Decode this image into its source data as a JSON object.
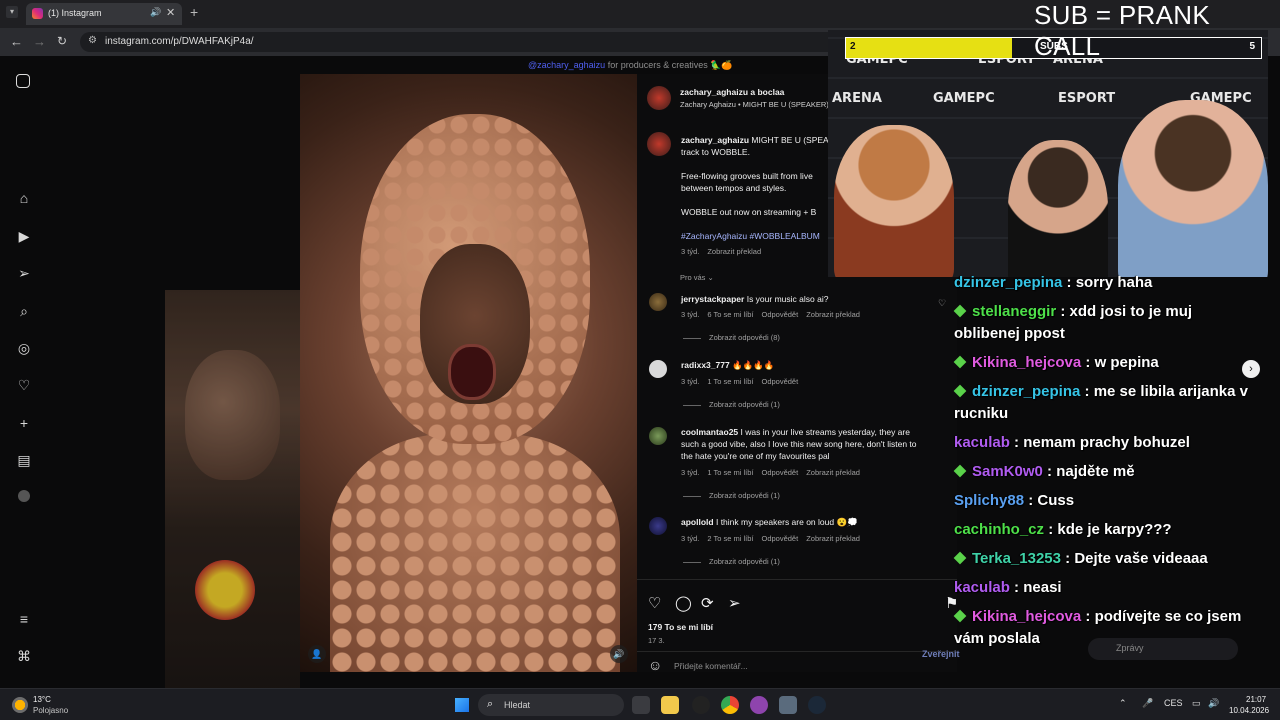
{
  "browser": {
    "tab_title": "(1) Instagram",
    "url": "instagram.com/p/DWAHFAKjP4a/"
  },
  "overlay": {
    "title": "SUB = PRANK CALL",
    "sub_goal": {
      "current": "2",
      "label": "SUBS",
      "target": "5",
      "progress": 0.4
    },
    "cam_brands": [
      "GAMEPC",
      "ESPORT",
      "ARENA"
    ]
  },
  "instagram": {
    "top_caption": {
      "handle": "@zachary_aghaizu",
      "text": " for producers & creatives 🦜🍊"
    },
    "header": {
      "user": "zachary_aghaizu a boclaa",
      "subtitle": "Zachary Aghaizu • MIGHT BE U (SPEAKER)"
    },
    "caption": {
      "user": "zachary_aghaizu",
      "line1": "MIGHT BE U (SPEA",
      "line2": "track to WOBBLE.",
      "para2_line1": "Free-flowing grooves built from live",
      "para2_line2": "between tempos and styles.",
      "para3": "WOBBLE out now on streaming + B",
      "hashtags": "#ZacharyAghaizu #WOBBLEALBUM",
      "time": "3 týd.",
      "translate": "Zobrazit překlad"
    },
    "for_you": "Pro vás ⌄",
    "comments": [
      {
        "user": "jerrystackpaper",
        "text": "Is your music also ai?",
        "time": "3 týd.",
        "likes": "6 To se mi líbí",
        "reply": "Odpovědět",
        "translate": "Zobrazit překlad",
        "replies": "Zobrazit odpovědi (8)"
      },
      {
        "user": "radixx3_777",
        "text": "🔥🔥🔥🔥",
        "time": "3 týd.",
        "likes": "1 To se mi líbí",
        "reply": "Odpovědět",
        "translate": "",
        "replies": "Zobrazit odpovědi (1)"
      },
      {
        "user": "coolmantao25",
        "text": "I was in your live streams yesterday, they are",
        "text2": "such a good vibe, also I love this new song here, don't listen to",
        "text3": "the hate you're one of my favourites pal",
        "time": "3 týd.",
        "likes": "1 To se mi líbí",
        "reply": "Odpovědět",
        "translate": "Zobrazit překlad",
        "replies": "Zobrazit odpovědi (1)"
      },
      {
        "user": "apollold",
        "text": "I think my speakers are on loud 😮💭",
        "time": "3 týd.",
        "likes": "2 To se mi líbí",
        "reply": "Odpovědět",
        "translate": "Zobrazit překlad",
        "replies": "Zobrazit odpovědi (1)"
      }
    ],
    "likes": "179 To se mi líbí",
    "date": "17 3.",
    "comment_placeholder": "Přidejte komentář...",
    "post_label": "Zveřejnit"
  },
  "chat": [
    {
      "user": "dzinzer_pepina",
      "msg": "sorry haha",
      "color": "#36c4e6",
      "badge": false
    },
    {
      "user": "stellaneggir",
      "msg": "xdd josi to je muj oblibenej ppost",
      "color": "#4ee04a",
      "badge": true
    },
    {
      "user": "Kikina_hejcova",
      "msg": "w pepina",
      "color": "#e05be0",
      "badge": true
    },
    {
      "user": "dzinzer_pepina",
      "msg": "me se libila arijanka v rucniku",
      "color": "#36c4e6",
      "badge": true
    },
    {
      "user": "kaculab",
      "msg": "nemam prachy bohuzel",
      "color": "#b05cf0",
      "badge": false
    },
    {
      "user": "SamK0w0",
      "msg": "najděte mě",
      "color": "#b05cf0",
      "badge": true
    },
    {
      "user": "Splichy88",
      "msg": "Cuss",
      "color": "#5aa0f0",
      "badge": false
    },
    {
      "user": "cachinho_cz",
      "msg": "kde je karpy???",
      "color": "#4ee04a",
      "badge": false
    },
    {
      "user": "Terka_13253",
      "msg": "Dejte vaše videaaa",
      "color": "#3fd2a8",
      "badge": true
    },
    {
      "user": "kaculab",
      "msg": "neasi",
      "color": "#b05cf0",
      "badge": false
    },
    {
      "user": "Kikina_hejcova",
      "msg": "podívejte se co jsem vám poslala",
      "color": "#e05be0",
      "badge": true
    }
  ],
  "chat_input": "Zprávy",
  "taskbar": {
    "weather_temp": "13°C",
    "weather_desc": "Polojasno",
    "search": "Hledat",
    "lang": "CES",
    "time": "21:07",
    "date": "10.04.2026"
  }
}
